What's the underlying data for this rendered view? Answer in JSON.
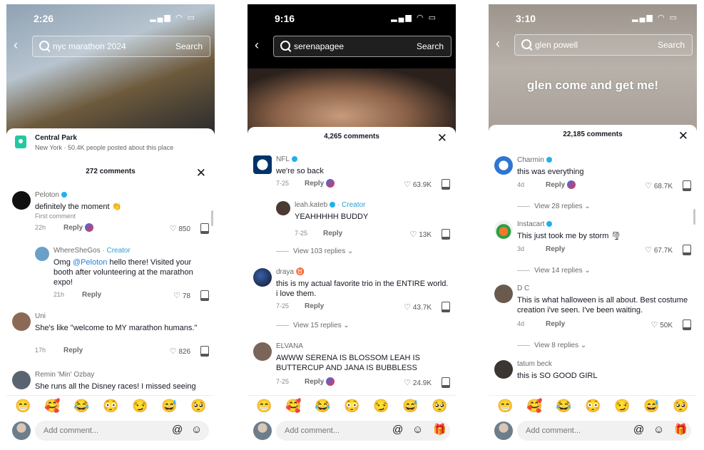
{
  "screens": [
    {
      "time": "2:26",
      "search": {
        "query": "nyc marathon 2024",
        "button": "Search"
      },
      "place": {
        "name": "Central Park",
        "sub": "New York · 50.4K people posted about this place"
      },
      "comments_count": "272 comments",
      "comments": [
        {
          "user": "Peloton",
          "text": "definitely the moment 👏",
          "first": "First comment",
          "date": "22h",
          "reply": "Reply",
          "likes": "850"
        },
        {
          "user": "WhereSheGos",
          "creator": "· Creator",
          "text_pre": "Omg ",
          "mention": "@Peloton",
          "text_post": " hello there! Visited your booth after volunteering at the marathon expo!",
          "date": "21h",
          "reply": "Reply",
          "likes": "78"
        },
        {
          "user": "Uni",
          "text": "She's like \"welcome to MY marathon humans.\"",
          "date": "17h",
          "reply": "Reply",
          "likes": "826"
        },
        {
          "user": "Remin 'Min' Ozbay",
          "text": "She runs all the Disney races! I missed seeing"
        }
      ],
      "input_placeholder": "Add comment..."
    },
    {
      "time": "9:16",
      "search": {
        "query": "serenapagee",
        "button": "Search"
      },
      "comments_count": "4,265 comments",
      "comments": [
        {
          "user": "NFL",
          "text": "we're so back",
          "date": "7-25",
          "reply": "Reply",
          "likes": "63.9K"
        },
        {
          "user": "leah.kateb",
          "creator": "· Creator",
          "text": "YEAHHHHH BUDDY",
          "date": "7-25",
          "reply": "Reply",
          "likes": "13K"
        },
        {
          "view_replies": "View 103 replies ⌄"
        },
        {
          "user": "draya ♉",
          "text": "this is my actual favorite trio in the ENTIRE world. i love them.",
          "date": "7-25",
          "reply": "Reply",
          "likes": "43.7K"
        },
        {
          "view_replies": "View 15 replies ⌄"
        },
        {
          "user": "ELVANA",
          "text": "AWWW SERENA IS BLOSSOM LEAH IS BUTTERCUP AND JANA IS BUBBLESS",
          "date": "7-25",
          "reply": "Reply",
          "likes": "24.9K"
        }
      ],
      "input_placeholder": "Add comment..."
    },
    {
      "time": "3:10",
      "search": {
        "query": "glen powell",
        "button": "Search"
      },
      "overlay_text": "glen come and get me!",
      "comments_count": "22,185 comments",
      "comments": [
        {
          "user": "Charmin",
          "text": "this was everything",
          "date": "4d",
          "reply": "Reply",
          "likes": "68.7K"
        },
        {
          "view_replies": "View 28 replies ⌄"
        },
        {
          "user": "Instacart",
          "text": "This just took me by storm 🌪",
          "date": "3d",
          "reply": "Reply",
          "likes": "67.7K"
        },
        {
          "view_replies": "View 14 replies ⌄"
        },
        {
          "user": "D C",
          "text": "This is what halloween is all about. Best costume creation i've seen. I've been waiting.",
          "date": "4d",
          "reply": "Reply",
          "likes": "50K"
        },
        {
          "view_replies": "View 8 replies ⌄"
        },
        {
          "user": "tatum beck",
          "text": "this is SO GOOD GIRL"
        }
      ],
      "input_placeholder": "Add comment..."
    }
  ],
  "emojis": [
    "😁",
    "🥰",
    "😂",
    "😳",
    "😏",
    "😅",
    "🥺"
  ],
  "icons": {
    "at": "@",
    "smile": "☺",
    "gift": "🎁",
    "back": "‹",
    "close": "✕",
    "heart": "♡"
  }
}
